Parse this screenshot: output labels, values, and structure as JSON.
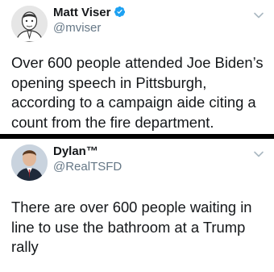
{
  "tweets": [
    {
      "name": "Matt Viser",
      "handle": "@mviser",
      "verified": true,
      "text": "Over 600 people attended Joe Biden’s opening speech in Pittsburgh, according to a campaign aide citing a count from the fire department."
    },
    {
      "name": "Dylan™",
      "handle": "@RealTSFD",
      "verified": false,
      "text": "There are over 600 people waiting in line to use the bathroom at a Trump rally"
    }
  ],
  "colors": {
    "background": "#000000",
    "card": "#ffffff",
    "text": "#14171a",
    "secondary": "#657786",
    "verified": "#1da1f2"
  },
  "icons": {
    "verified": "verified-badge-icon",
    "menu": "chevron-down-icon"
  }
}
